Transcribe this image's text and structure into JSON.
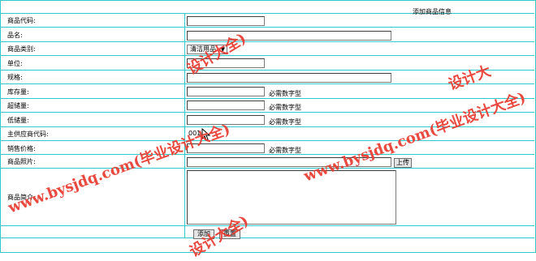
{
  "form": {
    "title": "添加商品信息",
    "code_label": "商品代码:",
    "code_value": "",
    "name_label": "品名:",
    "name_value": "",
    "category_label": "商品类别:",
    "category_value": "清洁用品",
    "unit_label": "单位:",
    "unit_value": "",
    "spec_label": "规格:",
    "spec_value": "",
    "stock_label": "库存量:",
    "stock_value": "",
    "stock_hint": "必需数字型",
    "overstock_label": "超储量:",
    "overstock_value": "",
    "overstock_hint": "必需数字型",
    "lowstock_label": "低储量:",
    "lowstock_value": "",
    "lowstock_hint": "必需数字型",
    "supplier_label": "主供应商代码:",
    "supplier_value": "001",
    "price_label": "销售价格:",
    "price_value": "",
    "price_hint": "必需数字型",
    "photo_label": "商品照片:",
    "photo_value": "",
    "upload_label": "上传",
    "intro_label": "商品简介:",
    "intro_value": "",
    "add_label": "添加",
    "reset_label": "重置"
  },
  "watermark": {
    "text": "www.bysjdq.com(毕业设计大全)",
    "fragment_top": "设计大全)",
    "fragment_right": "设计大",
    "fragment_bottom": "设计大全)",
    "color": "#e83a2e"
  },
  "colors": {
    "grid": "#33c9cc"
  }
}
